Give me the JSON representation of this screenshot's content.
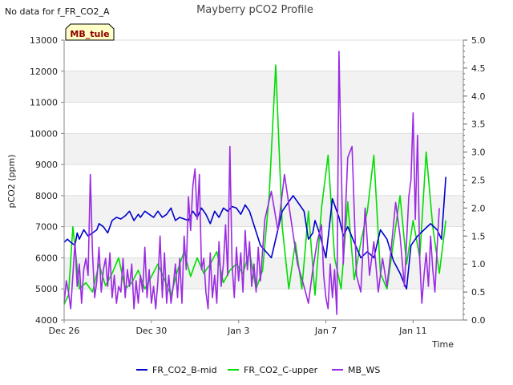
{
  "chart_data": {
    "type": "line",
    "title": "Mayberry pCO2 Profile",
    "note": "No data for f_FR_CO2_A",
    "tag": "MB_tule",
    "xlabel": "Time",
    "ylabel": "pCO2 (ppm)",
    "ylim": [
      4000,
      13000
    ],
    "y2lim": [
      0.0,
      5.0
    ],
    "xlim": [
      0,
      18.3
    ],
    "yticks": [
      "4000",
      "5000",
      "6000",
      "7000",
      "8000",
      "9000",
      "10000",
      "11000",
      "12000",
      "13000"
    ],
    "y2ticks": [
      "0.0",
      "0.5",
      "1.0",
      "1.5",
      "2.0",
      "2.5",
      "3.0",
      "3.5",
      "4.0",
      "4.5",
      "5.0"
    ],
    "xticks": [
      {
        "label": "Dec 26",
        "day": 0
      },
      {
        "label": "Dec 30",
        "day": 4
      },
      {
        "label": "Jan 3",
        "day": 8
      },
      {
        "label": "Jan 7",
        "day": 12
      },
      {
        "label": "Jan 11",
        "day": 16
      }
    ],
    "grid": "horizontal alternating bands",
    "legend_position": "bottom",
    "series": [
      {
        "name": "FR_CO2_B-mid",
        "axis": "left",
        "color": "#0000cc",
        "x": [
          0,
          0.15,
          0.3,
          0.5,
          0.6,
          0.7,
          0.9,
          1.1,
          1.3,
          1.5,
          1.6,
          1.8,
          2.0,
          2.2,
          2.4,
          2.6,
          2.8,
          3.0,
          3.2,
          3.4,
          3.5,
          3.7,
          3.9,
          4.1,
          4.3,
          4.5,
          4.7,
          4.9,
          5.1,
          5.3,
          5.5,
          5.7,
          5.9,
          6.1,
          6.3,
          6.5,
          6.7,
          6.9,
          7.1,
          7.3,
          7.5,
          7.7,
          7.9,
          8.1,
          8.3,
          8.5,
          9.0,
          9.5,
          10.0,
          10.3,
          10.5,
          10.8,
          11.0,
          11.2,
          11.4,
          11.5,
          11.7,
          12.0,
          12.3,
          12.6,
          12.8,
          13.0,
          13.3,
          13.6,
          13.9,
          14.2,
          14.5,
          14.8,
          15.1,
          15.4,
          15.7,
          15.9,
          16.2,
          16.5,
          16.8,
          17.1,
          17.3,
          17.5
        ],
        "y": [
          6500,
          6600,
          6500,
          6400,
          6800,
          6600,
          6900,
          6700,
          6800,
          6900,
          7100,
          7000,
          6800,
          7200,
          7300,
          7250,
          7350,
          7500,
          7200,
          7400,
          7300,
          7500,
          7400,
          7300,
          7500,
          7300,
          7400,
          7600,
          7200,
          7300,
          7250,
          7200,
          7500,
          7300,
          7600,
          7400,
          7100,
          7500,
          7300,
          7600,
          7500,
          7650,
          7600,
          7400,
          7700,
          7500,
          6400,
          6000,
          7500,
          7800,
          8000,
          7700,
          7500,
          6600,
          6800,
          7200,
          6800,
          6000,
          7900,
          7300,
          6700,
          7000,
          6500,
          6000,
          6200,
          6000,
          6900,
          6600,
          5900,
          5500,
          5000,
          6400,
          6700,
          6900,
          7100,
          6900,
          6600,
          8600
        ]
      },
      {
        "name": "FR_CO2_C-upper",
        "axis": "left",
        "color": "#00dd00",
        "x": [
          0,
          0.2,
          0.4,
          0.7,
          1.0,
          1.3,
          1.6,
          1.9,
          2.2,
          2.5,
          2.8,
          3.1,
          3.4,
          3.7,
          4.0,
          4.3,
          4.6,
          4.9,
          5.2,
          5.5,
          5.8,
          6.1,
          6.4,
          6.7,
          7.0,
          7.3,
          7.6,
          7.9,
          8.2,
          8.5,
          8.8,
          9.1,
          9.4,
          9.7,
          10.0,
          10.3,
          10.6,
          10.9,
          11.2,
          11.5,
          11.8,
          12.1,
          12.4,
          12.7,
          13.0,
          13.3,
          13.6,
          13.9,
          14.2,
          14.5,
          14.8,
          15.1,
          15.4,
          15.7,
          16.0,
          16.3,
          16.6,
          16.9,
          17.2,
          17.5
        ],
        "y": [
          4500,
          4800,
          7000,
          5000,
          5200,
          4900,
          5800,
          5100,
          5500,
          6000,
          5000,
          5200,
          5600,
          5000,
          5400,
          5800,
          5300,
          4800,
          5600,
          6200,
          5400,
          6000,
          5500,
          5800,
          6200,
          5200,
          5600,
          5800,
          5500,
          6200,
          5000,
          5600,
          8000,
          12200,
          7000,
          5000,
          6500,
          5000,
          7500,
          4800,
          7600,
          9300,
          6000,
          5000,
          7800,
          5300,
          6500,
          7500,
          9300,
          5500,
          5000,
          6500,
          8000,
          5800,
          7200,
          6000,
          9400,
          7000,
          5500,
          7200
        ]
      },
      {
        "name": "MB_WS",
        "axis": "right",
        "color": "#9a2be2",
        "x": [
          0,
          0.1,
          0.2,
          0.3,
          0.4,
          0.5,
          0.6,
          0.7,
          0.8,
          0.9,
          1.0,
          1.1,
          1.2,
          1.3,
          1.4,
          1.5,
          1.6,
          1.7,
          1.8,
          1.9,
          2.0,
          2.1,
          2.2,
          2.3,
          2.4,
          2.5,
          2.6,
          2.7,
          2.8,
          2.9,
          3.0,
          3.1,
          3.2,
          3.3,
          3.4,
          3.5,
          3.6,
          3.7,
          3.8,
          3.9,
          4.0,
          4.1,
          4.2,
          4.3,
          4.4,
          4.5,
          4.6,
          4.7,
          4.8,
          4.9,
          5.0,
          5.1,
          5.2,
          5.3,
          5.4,
          5.5,
          5.6,
          5.7,
          5.8,
          5.9,
          6.0,
          6.1,
          6.2,
          6.3,
          6.4,
          6.5,
          6.6,
          6.7,
          6.8,
          6.9,
          7.0,
          7.1,
          7.2,
          7.3,
          7.4,
          7.5,
          7.6,
          7.7,
          7.8,
          7.9,
          8.0,
          8.1,
          8.2,
          8.3,
          8.4,
          8.5,
          8.6,
          8.7,
          8.8,
          8.9,
          9.0,
          9.2,
          9.5,
          9.8,
          10.1,
          10.4,
          10.7,
          11.0,
          11.2,
          11.4,
          11.6,
          11.8,
          11.9,
          12.0,
          12.1,
          12.2,
          12.3,
          12.4,
          12.5,
          12.6,
          12.8,
          13.0,
          13.2,
          13.4,
          13.6,
          13.8,
          14.0,
          14.2,
          14.4,
          14.6,
          14.8,
          15.0,
          15.2,
          15.4,
          15.6,
          15.8,
          15.9,
          16.0,
          16.1,
          16.2,
          16.3,
          16.4,
          16.5,
          16.6,
          16.7,
          16.8,
          16.9,
          17.0,
          17.1,
          17.2
        ],
        "y": [
          0.3,
          0.7,
          0.5,
          0.2,
          0.8,
          1.4,
          0.6,
          1.0,
          0.3,
          0.9,
          1.1,
          0.8,
          2.6,
          1.2,
          0.4,
          0.7,
          1.3,
          0.5,
          0.9,
          1.1,
          0.6,
          1.2,
          0.4,
          0.8,
          0.3,
          0.6,
          0.5,
          1.1,
          0.4,
          0.9,
          0.6,
          1.0,
          0.2,
          0.7,
          0.3,
          0.8,
          0.5,
          1.3,
          0.4,
          0.9,
          0.3,
          0.6,
          0.2,
          0.7,
          1.5,
          0.4,
          1.2,
          0.3,
          0.8,
          0.3,
          0.6,
          1.0,
          0.4,
          1.1,
          0.3,
          1.5,
          0.9,
          2.2,
          1.6,
          2.4,
          2.7,
          1.8,
          2.6,
          0.9,
          1.1,
          0.5,
          0.2,
          1.2,
          0.4,
          0.8,
          0.3,
          1.4,
          0.6,
          1.0,
          1.7,
          0.8,
          3.1,
          1.0,
          0.4,
          1.3,
          0.7,
          1.2,
          0.5,
          1.6,
          0.9,
          1.4,
          0.6,
          1.0,
          0.5,
          1.3,
          0.7,
          1.8,
          2.3,
          1.6,
          2.6,
          1.8,
          1.0,
          0.6,
          0.3,
          0.9,
          1.4,
          1.7,
          0.8,
          0.4,
          0.2,
          1.0,
          0.4,
          0.9,
          0.1,
          4.8,
          1.0,
          2.9,
          3.1,
          0.8,
          0.5,
          2.0,
          0.8,
          1.4,
          0.5,
          1.1,
          0.6,
          1.3,
          2.1,
          1.5,
          0.6,
          2.2,
          2.5,
          3.7,
          1.8,
          3.3,
          1.1,
          0.3,
          0.8,
          1.2,
          0.6,
          1.5,
          0.9,
          0.5,
          1.3,
          2.0
        ]
      }
    ]
  }
}
